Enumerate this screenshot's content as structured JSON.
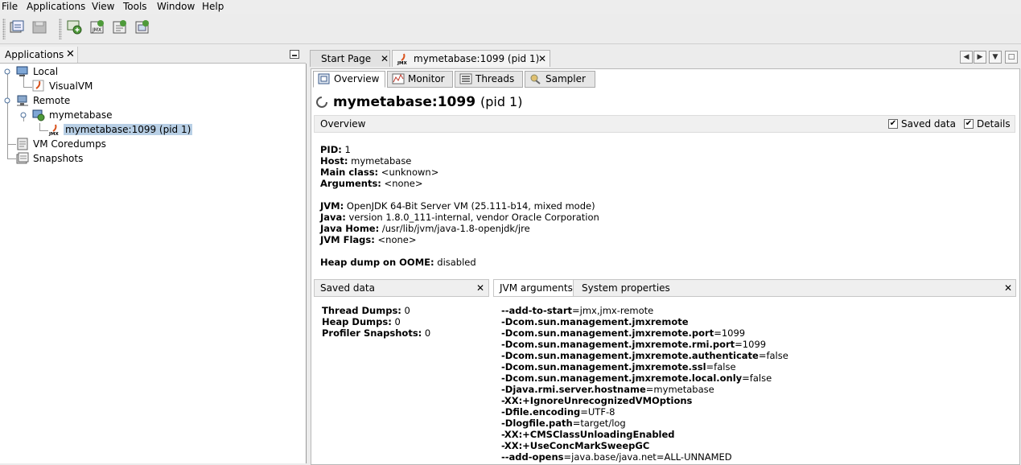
{
  "menu": [
    "File",
    "Applications",
    "View",
    "Tools",
    "Window",
    "Help"
  ],
  "left_panel": {
    "tab_label": "Applications",
    "close": "✕",
    "tree": {
      "local": "Local",
      "visualvm": "VisualVM",
      "remote": "Remote",
      "host": "mymetabase",
      "jmx": "mymetabase:1099 (pid 1)",
      "coredumps": "VM Coredumps",
      "snapshots": "Snapshots"
    }
  },
  "doc_tabs": {
    "start": "Start Page",
    "active": "mymetabase:1099 (pid 1)",
    "close": "✕"
  },
  "sub_tabs": [
    "Overview",
    "Monitor",
    "Threads",
    "Sampler"
  ],
  "title": {
    "name": "mymetabase:1099",
    "pid": "(pid 1)"
  },
  "overview_header": {
    "label": "Overview",
    "saved_data": "Saved data",
    "details": "Details",
    "check": "✔"
  },
  "info": {
    "pid_k": "PID:",
    "pid_v": " 1",
    "host_k": "Host:",
    "host_v": " mymetabase",
    "main_k": "Main class:",
    "main_v": " <unknown>",
    "args_k": "Arguments:",
    "args_v": " <none>",
    "jvm_k": "JVM:",
    "jvm_v": " OpenJDK 64-Bit Server VM (25.111-b14, mixed mode)",
    "java_k": "Java:",
    "java_v": " version 1.8.0_111-internal, vendor Oracle Corporation",
    "home_k": "Java Home:",
    "home_v": " /usr/lib/jvm/java-1.8-openjdk/jre",
    "flags_k": "JVM Flags:",
    "flags_v": " <none>",
    "heap_k": "Heap dump on OOME:",
    "heap_v": " disabled"
  },
  "saved_data": {
    "header": "Saved data",
    "thread_k": "Thread Dumps:",
    "thread_v": " 0",
    "heap_k": "Heap Dumps:",
    "heap_v": " 0",
    "prof_k": "Profiler Snapshots:",
    "prof_v": " 0"
  },
  "jvm_tabs": {
    "args": "JVM arguments",
    "props": "System properties"
  },
  "jvm_args": [
    {
      "k": "--add-to-start",
      "v": "=jmx,jmx-remote"
    },
    {
      "k": "-Dcom.sun.management.jmxremote",
      "v": ""
    },
    {
      "k": "-Dcom.sun.management.jmxremote.port",
      "v": "=1099"
    },
    {
      "k": "-Dcom.sun.management.jmxremote.rmi.port",
      "v": "=1099"
    },
    {
      "k": "-Dcom.sun.management.jmxremote.authenticate",
      "v": "=false"
    },
    {
      "k": "-Dcom.sun.management.jmxremote.ssl",
      "v": "=false"
    },
    {
      "k": "-Dcom.sun.management.jmxremote.local.only",
      "v": "=false"
    },
    {
      "k": "-Djava.rmi.server.hostname",
      "v": "=mymetabase"
    },
    {
      "k": "-XX:+IgnoreUnrecognizedVMOptions",
      "v": ""
    },
    {
      "k": "-Dfile.encoding",
      "v": "=UTF-8"
    },
    {
      "k": "-Dlogfile.path",
      "v": "=target/log"
    },
    {
      "k": "-XX:+CMSClassUnloadingEnabled",
      "v": ""
    },
    {
      "k": "-XX:+UseConcMarkSweepGC",
      "v": ""
    },
    {
      "k": "--add-opens",
      "v": "=java.base/java.net=ALL-UNNAMED"
    }
  ]
}
